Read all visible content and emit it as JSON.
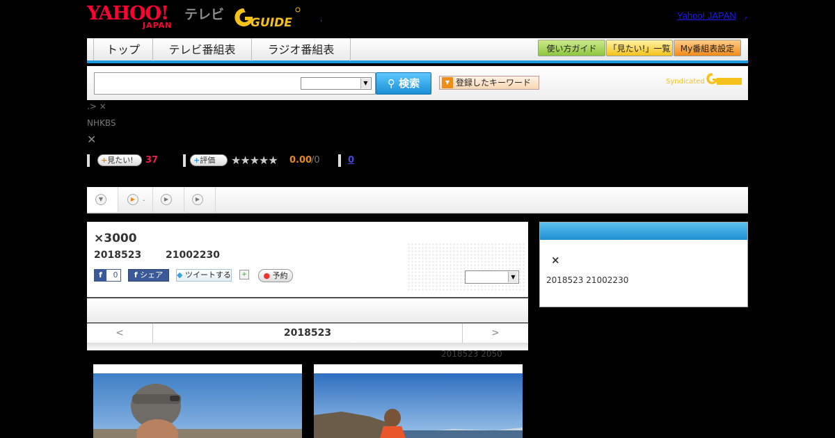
{
  "header": {
    "yahoo_logo": "YAHOO!",
    "yahoo_japan": "JAPAN",
    "tv_label": "テレビ",
    "gguide_logo": "GUIDE",
    "yahoo_japan_link": "Yahoo! JAPAN",
    "link_sep": ",",
    "dot": ","
  },
  "nav": {
    "tabs": [
      {
        "label": "トップ"
      },
      {
        "label": "テレビ番組表"
      },
      {
        "label": "ラジオ番組表"
      }
    ],
    "utility": [
      {
        "label": "使い方ガイド"
      },
      {
        "label": "「見たい!」一覧"
      },
      {
        "label": "My番組表設定"
      }
    ]
  },
  "search": {
    "query_value": "",
    "area_select": "",
    "button_label": "検索",
    "keyword_button_label": "登録したキーワード",
    "syndicated_label": "Syndicated"
  },
  "breadcrumb": ".> ×",
  "channel": "NHKBS",
  "program_mark": "✕",
  "stats": {
    "want_label": "見たい!",
    "want_count": "37",
    "rate_label": "評価",
    "rating": "0.00",
    "rating_count": "/0",
    "review_count": "0"
  },
  "tabstrip": {
    "tab2_label": "."
  },
  "program": {
    "title": "×3000",
    "date": "2018523",
    "time": "21002230",
    "like_count": "0",
    "share_label": "シェア",
    "tweet_label": "ツイートする",
    "reserve_label": "予約",
    "select_value": ""
  },
  "datenav": {
    "prev": "<",
    "current": "2018523",
    "next": ">"
  },
  "updated": "2018523  2050",
  "sidepanel": {
    "mark": "×",
    "schedule": "2018523  21002230"
  },
  "colors": {
    "accent_blue": "#1e9be0",
    "brand_red": "#ff0033",
    "gguide_yellow": "#f4c21a",
    "want_red": "#e8204a",
    "rating_orange": "#e68a1e"
  }
}
